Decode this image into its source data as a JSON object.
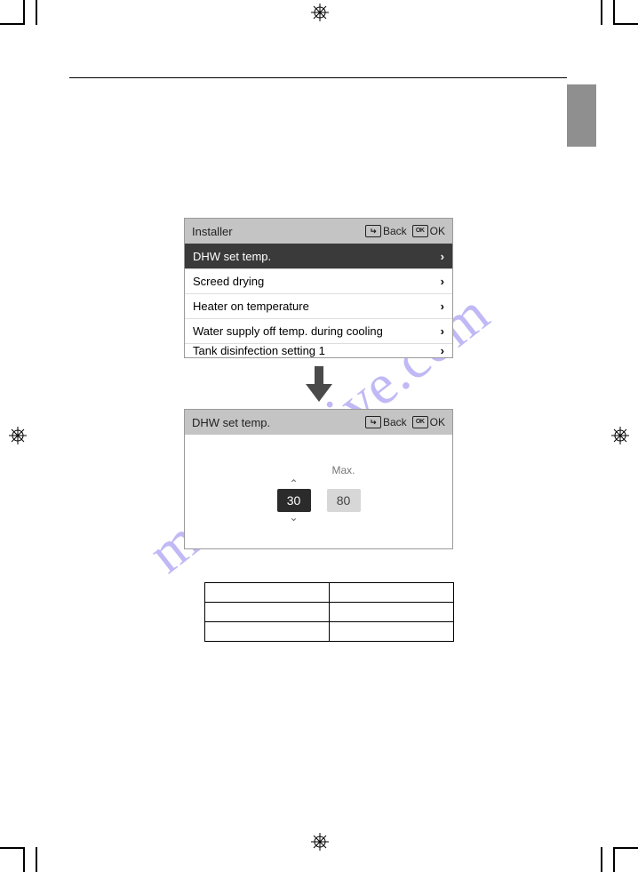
{
  "screen1": {
    "title": "Installer",
    "back": "Back",
    "ok": "OK",
    "rows": [
      {
        "label": "DHW set temp.",
        "selected": true
      },
      {
        "label": "Screed drying",
        "selected": false
      },
      {
        "label": "Heater on temperature",
        "selected": false
      },
      {
        "label": "Water supply off temp. during cooling",
        "selected": false
      },
      {
        "label": "Tank disinfection setting 1",
        "selected": false
      }
    ]
  },
  "screen2": {
    "title": "DHW set temp.",
    "back": "Back",
    "ok": "OK",
    "max_label": "Max.",
    "value_current": "30",
    "value_max": "80"
  },
  "table": {
    "r1c1": "",
    "r1c2": "",
    "r2c1": "",
    "r2c2": "",
    "r3c1": "",
    "r3c2": ""
  },
  "watermark": "manualshive.com"
}
